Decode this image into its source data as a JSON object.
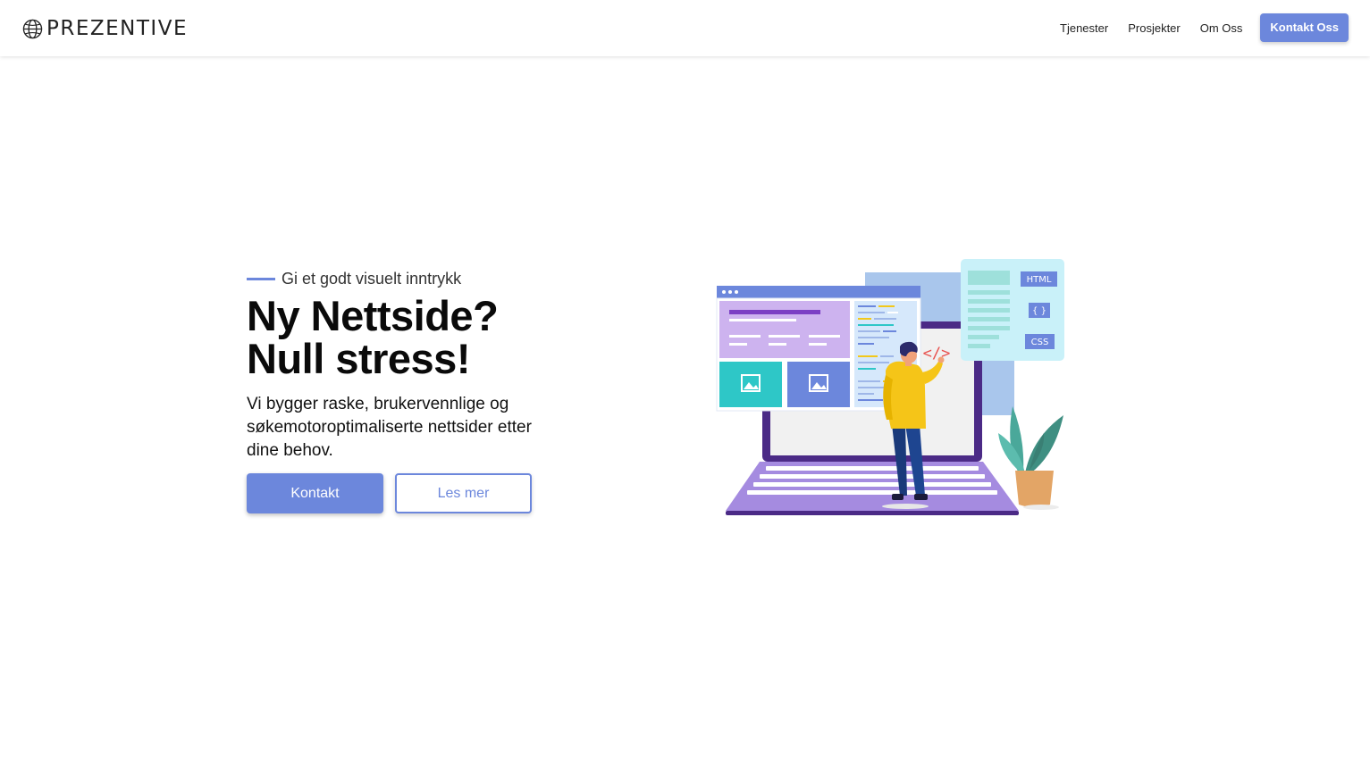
{
  "brand": {
    "name": "PREZENTIVE",
    "logo_icon": "globe-icon"
  },
  "nav": {
    "links": [
      "Tjenester",
      "Prosjekter",
      "Om Oss"
    ],
    "cta_label": "Kontakt Oss",
    "accent_color": "#6c87dc"
  },
  "hero": {
    "eyebrow": "Gi et godt visuelt inntrykk",
    "headline_line1": "Ny Nettside?",
    "headline_line2": "Null stress!",
    "lede": "Vi bygger raske, brukervennlige og søkemotoroptimaliserte nettsider etter dine behov.",
    "primary_button": "Kontakt",
    "secondary_button": "Les mer",
    "illustration": {
      "tags": [
        "HTML",
        "{ }",
        "CSS"
      ],
      "code_symbol": "</>"
    }
  }
}
